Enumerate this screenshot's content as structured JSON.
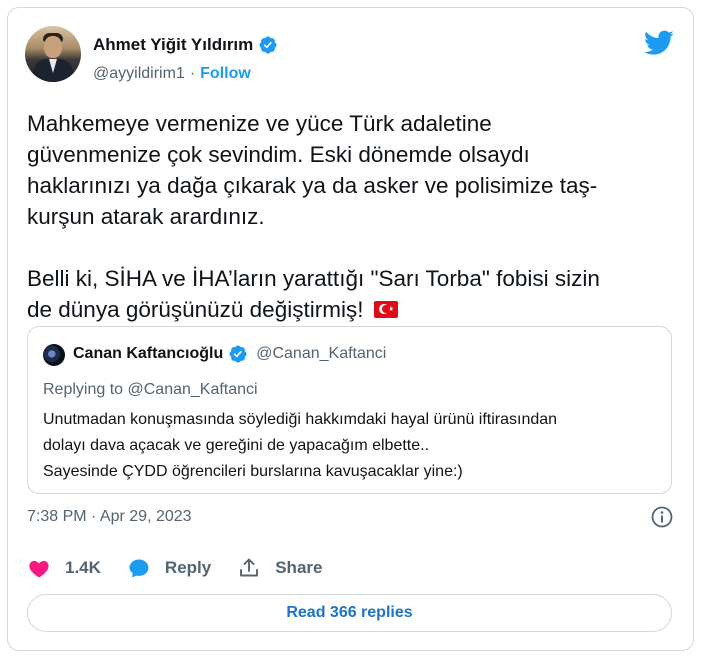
{
  "author": {
    "name": "Ahmet Yiğit Yıldırım",
    "handle": "@ayyildirim1",
    "separator": "·",
    "follow_label": "Follow",
    "verified": true
  },
  "platform_icon": "twitter-bird-icon",
  "tweet": {
    "text": "Mahkemeye vermenize ve yüce Türk adaletine\ngüvenmenize çok sevindim. Eski dönemde olsaydı\nhaklarınızı ya dağa çıkarak ya da asker ve polisimize taş-\nkurşun atarak arardınız.\n\nBelli ki, SİHA ve İHA’ların yarattığı \"Sarı Torba\" fobisi sizin\nde dünya görüşünüzü değiştirmiş!",
    "emoji": "turkey-flag"
  },
  "quoted": {
    "name": "Canan Kaftancıoğlu",
    "handle": "@Canan_Kaftanci",
    "verified": true,
    "replying_to": "Replying to @Canan_Kaftanci",
    "text": "Unutmadan konuşmasında söylediği hakkımdaki hayal ürünü iftirasından\ndolayı dava açacak ve gereğini de yapacağım elbette..\nSayesinde ÇYDD öğrencileri burslarına kavuşacaklar yine:)"
  },
  "timestamp": "7:38 PM · Apr 29, 2023",
  "actions": {
    "like_count": "1.4K",
    "reply_label": "Reply",
    "share_label": "Share"
  },
  "read_replies_label": "Read 366 replies",
  "colors": {
    "accent": "#1d9bf0",
    "like": "#f91880",
    "muted": "#536471",
    "border": "#cfd9de"
  }
}
